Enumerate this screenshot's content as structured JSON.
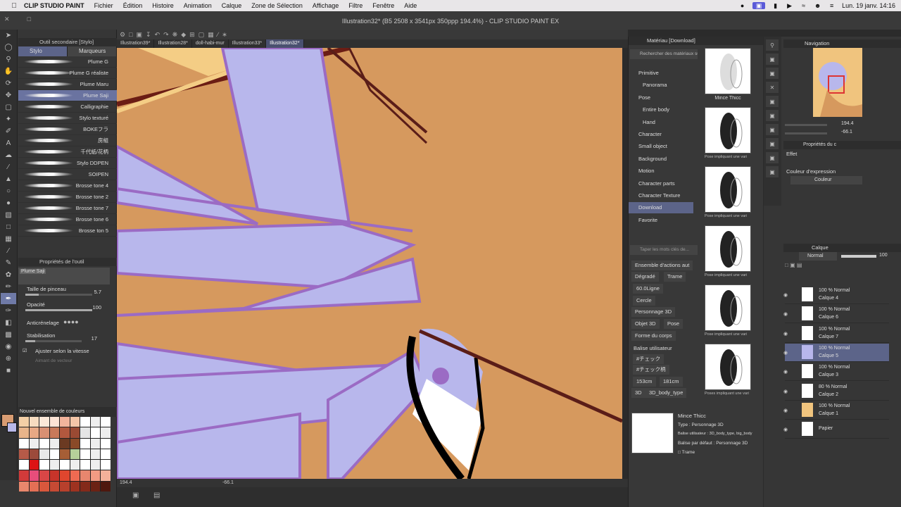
{
  "menubar": {
    "app": "CLIP STUDIO PAINT",
    "items": [
      "Fichier",
      "Édition",
      "Histoire",
      "Animation",
      "Calque",
      "Zone de Sélection",
      "Affichage",
      "Filtre",
      "Fenêtre",
      "Aide"
    ],
    "datetime": "Lun. 19 janv. 14:16"
  },
  "window": {
    "title": "Illustration32* (B5 2508 x 3541px 350ppp 194.4%) - CLIP STUDIO PAINT EX"
  },
  "tabs": [
    "Illustration39*",
    "Illustration28*",
    "doll-habi-mur",
    "Illustration33*",
    "Illustration32*"
  ],
  "active_tab": "Illustration32*",
  "subtool": {
    "title": "Outil secondaire [Stylo]",
    "tab_stylo": "Stylo",
    "tab_marqueurs": "Marqueurs",
    "brushes": [
      "Plume G",
      "Plume G réaliste",
      "Plume Maru",
      "Plume Saji",
      "Calligraphie",
      "Stylo texturé",
      "BOKEフラ",
      "房組",
      "千代紙/花柄",
      "Stylo DDPEN",
      "SOIPEN",
      "Brosse tone 4",
      "Brosse tone 2",
      "Brosse tone 7",
      "Brosse tone 6",
      "Brosse ton 5"
    ],
    "selected": "Plume Saji"
  },
  "tool_props": {
    "title": "Propriétés de l'outil",
    "name": "Plume Saji",
    "brush_size_label": "Taille de pinceau",
    "brush_size": "5.7",
    "opacity_label": "Opacité",
    "opacity": "100",
    "aa_label": "Anticrénelage",
    "stab_label": "Stabilisation",
    "stab": "17",
    "speed_label": "Ajuster selon la vitesse",
    "vector_label": "Aimant de vecteur"
  },
  "palette": {
    "title": "Nouvel ensemble de couleurs",
    "colors": [
      "#f3cfa6",
      "#f6dcc0",
      "#fbe8d8",
      "#fde4d6",
      "#f2b49c",
      "#f4c6a8",
      "#fff",
      "#eee",
      "#fff",
      "#e8b48a",
      "#e7a884",
      "#d89073",
      "#c8795a",
      "#b2583e",
      "#9a4a33",
      "#e5e5e5",
      "#fff",
      "#eee",
      "#fff",
      "#eee",
      "#fff",
      "#eee",
      "#6b3a22",
      "#8a4a28",
      "#fff",
      "#eee",
      "#fff",
      "#b65a48",
      "#9c4a3b",
      "#e8e8e8",
      "#ffffff",
      "#a65e36",
      "#b6d09a",
      "#fff",
      "#eee",
      "#fff",
      "#fff",
      "#dd1414",
      "#fff",
      "#eee",
      "#fff",
      "#eee",
      "#fff",
      "#eee",
      "#fff",
      "#d23a3a",
      "#e74d7b",
      "#d94646",
      "#c7342a",
      "#e0462e",
      "#ef6a52",
      "#e8866e",
      "#f29b83",
      "#f3b19a",
      "#e8876c",
      "#e36f55",
      "#d9573c",
      "#c64a34",
      "#b7402c",
      "#9e3220",
      "#842a1a",
      "#6b2214",
      "#4e180e"
    ]
  },
  "canvas": {
    "zoom": "194.4",
    "angle": "-66.1",
    "bg_color": "#d6995e"
  },
  "material": {
    "title": "Matériau [Download]",
    "search_placeholder": "Rechercher des matériaux su",
    "categories": [
      "Primitive",
      "Panorama",
      "Pose",
      "Entire body",
      "Hand",
      "Character",
      "Small object",
      "Background",
      "Motion",
      "Character parts",
      "Character Texture",
      "Download",
      "Favorite"
    ],
    "selected_category": "Download",
    "keyword_placeholder": "Taper les mots clés de...",
    "tags": [
      "Ensemble d'actions aut",
      "Dégradé",
      "Trame",
      "60.0Ligne",
      "Cercle",
      "Personnage 3D",
      "Objet 3D",
      "Pose",
      "Forme du corps",
      "Balise utilisateur",
      "#チェック",
      "#チェック柄",
      "153cm",
      "181cm",
      "3D",
      "3D_body_type"
    ],
    "thumbs": [
      {
        "label": "Mince Thicc"
      },
      {
        "label": "Pose impliquant une vari"
      },
      {
        "label": "Pose impliquant une vari"
      },
      {
        "label": "Pose impliquant une vari"
      },
      {
        "label": "Pose impliquant une vari"
      },
      {
        "label": "Poses impliquant une vari"
      }
    ],
    "detail": {
      "name": "Mince Thicc",
      "type": "Type : Personnage 3D",
      "user_tags": "Balise utilisateur : 3D_body_type, big_body",
      "default_tag": "Balise par défaut : Personnage 3D",
      "screen": "Trame"
    }
  },
  "navigator": {
    "title": "Navigation",
    "zoom": "194.4",
    "angle": "-66.1"
  },
  "layer_props": {
    "title": "Propriétés du c",
    "effect_label": "Effet",
    "expr_label": "Couleur d'expression",
    "expr_value": "Couleur"
  },
  "layers": {
    "title": "Calque",
    "blend": "Normal",
    "opacity": "100",
    "items": [
      {
        "pct": "100 % Normal",
        "name": "Calque 4"
      },
      {
        "pct": "100 % Normal",
        "name": "Calque 6"
      },
      {
        "pct": "100 % Normal",
        "name": "Calque 7"
      },
      {
        "pct": "100 % Normal",
        "name": "Calque 5"
      },
      {
        "pct": "100 % Normal",
        "name": "Calque 3"
      },
      {
        "pct": "80 % Normal",
        "name": "Calque 2"
      },
      {
        "pct": "100 % Normal",
        "name": "Calque 1"
      },
      {
        "pct": "",
        "name": "Papier"
      }
    ],
    "selected": "Calque 5"
  }
}
